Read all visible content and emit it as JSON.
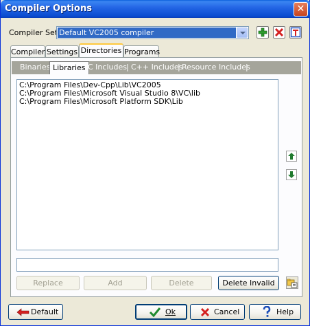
{
  "window": {
    "title": "Compiler Options",
    "close_glyph": "✕"
  },
  "compiler_set": {
    "label": "Compiler Set :",
    "selected": "Default VC2005 compiler"
  },
  "tabs": [
    {
      "label": "Compiler"
    },
    {
      "label": "Settings"
    },
    {
      "label": "Directories",
      "active": true
    },
    {
      "label": "Programs"
    }
  ],
  "subtabs": [
    {
      "label": "Binaries"
    },
    {
      "label": "Libraries",
      "active": true
    },
    {
      "label": "C Includes"
    },
    {
      "label": "C++ Includes"
    },
    {
      "label": "Resource Includes"
    }
  ],
  "subtab_separator": "|",
  "directories": [
    "C:\\Program Files\\Dev-Cpp\\Lib\\VC2005",
    "C:\\Program Files\\Microsoft Visual Studio 8\\VC\\lib",
    "C:\\Program Files\\Microsoft Platform SDK\\Lib"
  ],
  "path_input": {
    "value": ""
  },
  "actions": {
    "replace": "Replace",
    "add": "Add",
    "delete": "Delete",
    "delete_invalid": "Delete Invalid"
  },
  "footer": {
    "default": "Default",
    "ok": "Ok",
    "cancel": "Cancel",
    "help": "Help"
  },
  "colors": {
    "titlebar": "#0A4CD0",
    "selection": "#316AC5",
    "window_bg": "#ECE9D8",
    "active_tab_accent": "#FFC83C"
  },
  "icons": {
    "add_compiler_set": "green-plus-icon",
    "delete_compiler_set": "red-x-icon",
    "rename_compiler_set": "rename-icon",
    "move_up": "green-up-arrow-icon",
    "move_down": "green-down-arrow-icon",
    "browse": "browse-folder-icon",
    "default": "red-left-arrow-icon",
    "ok": "green-check-icon",
    "cancel": "red-x-icon",
    "help": "question-mark-icon"
  }
}
